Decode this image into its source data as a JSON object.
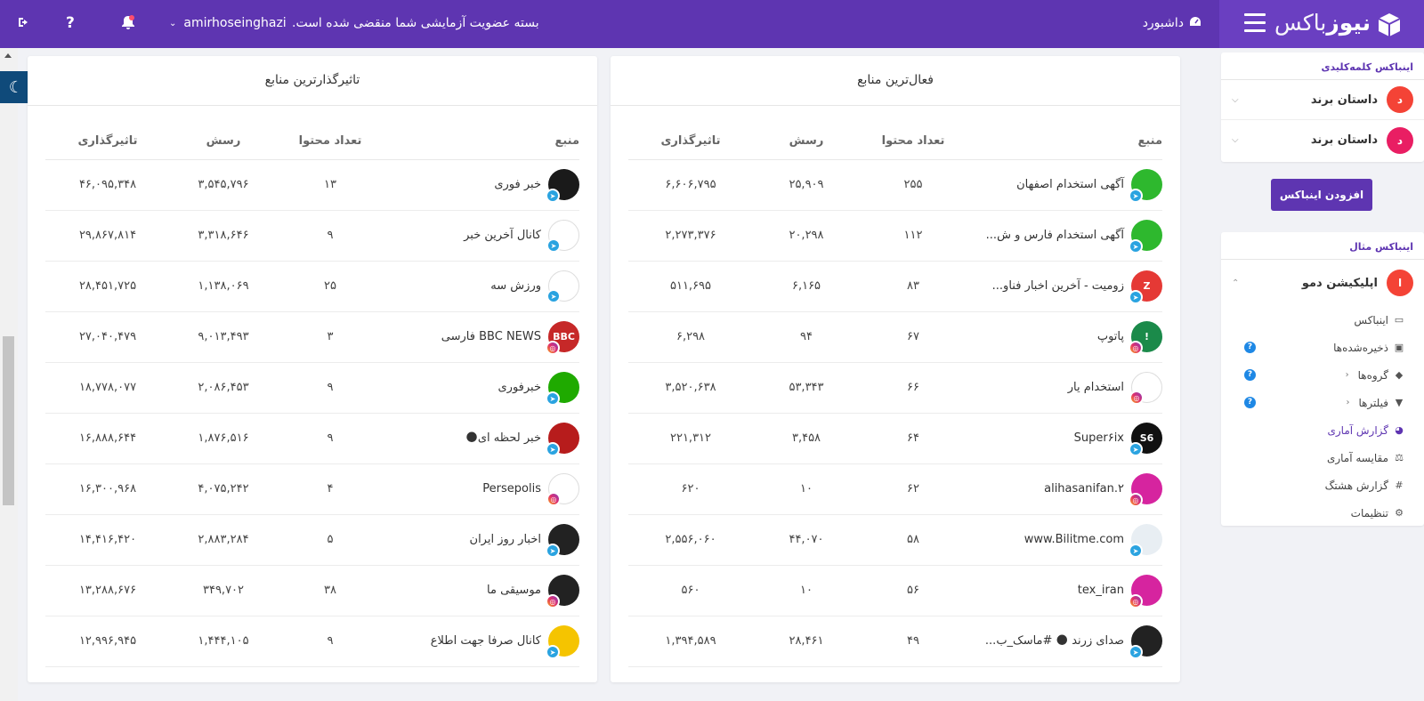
{
  "topbar": {
    "brand_bold": "نیوز",
    "brand_light": "باکس",
    "dashboard_label": "داشبورد",
    "subscription_msg": "بسته عضویت آزمایشی شما منقضی شده است.",
    "username": "amirhoseinghazi",
    "help_label": "?",
    "bar_color": "#5e35b1"
  },
  "active_sources": {
    "title": "فعال‌ترین منابع",
    "headers": [
      "منبع",
      "تعداد محتوا",
      "رسش",
      "تاثیرگذاری"
    ],
    "rows": [
      {
        "name": "آگهی استخدام اصفهان",
        "count": "۲۵۵",
        "reach": "۲۵,۹۰۹",
        "impact": "۶,۶۰۶,۷۹۵",
        "platform": "tg",
        "avatar_color": "#2eb82e",
        "avatar_text": ""
      },
      {
        "name": "آگهی استخدام فارس و ش...",
        "count": "۱۱۲",
        "reach": "۲۰,۲۹۸",
        "impact": "۲,۲۷۳,۳۷۶",
        "platform": "tg",
        "avatar_color": "#2eb82e",
        "avatar_text": ""
      },
      {
        "name": "زومیت - آخرین اخبار فناو...",
        "count": "۸۳",
        "reach": "۶,۱۶۵",
        "impact": "۵۱۱,۶۹۵",
        "platform": "tg",
        "avatar_color": "#e53935",
        "avatar_text": "Z"
      },
      {
        "name": "پاتوپ",
        "count": "۶۷",
        "reach": "۹۴",
        "impact": "۶,۲۹۸",
        "platform": "ig",
        "avatar_color": "#1b8a4a",
        "avatar_text": "!"
      },
      {
        "name": "استخدام یار",
        "count": "۶۶",
        "reach": "۵۳,۳۴۳",
        "impact": "۳,۵۲۰,۶۳۸",
        "platform": "ig",
        "avatar_color": "#ffffff",
        "avatar_text": ""
      },
      {
        "name": "Super۶ix",
        "count": "۶۴",
        "reach": "۳,۴۵۸",
        "impact": "۲۲۱,۳۱۲",
        "platform": "tg",
        "avatar_color": "#111111",
        "avatar_text": "S6"
      },
      {
        "name": "alihasanifan.۲",
        "count": "۶۲",
        "reach": "۱۰",
        "impact": "۶۲۰",
        "platform": "ig",
        "avatar_color": "#d6249f",
        "avatar_text": ""
      },
      {
        "name": "www.Bilitme.com",
        "count": "۵۸",
        "reach": "۴۴,۰۷۰",
        "impact": "۲,۵۵۶,۰۶۰",
        "platform": "tg",
        "avatar_color": "#e8eef3",
        "avatar_text": ""
      },
      {
        "name": "tex_iran",
        "count": "۵۶",
        "reach": "۱۰",
        "impact": "۵۶۰",
        "platform": "ig",
        "avatar_color": "#d6249f",
        "avatar_text": ""
      },
      {
        "name": "صدای زرند 🌑 #ماسک_ب...",
        "count": "۴۹",
        "reach": "۲۸,۴۶۱",
        "impact": "۱,۳۹۴,۵۸۹",
        "platform": "tg",
        "avatar_color": "#222222",
        "avatar_text": ""
      }
    ]
  },
  "influential_sources": {
    "title": "تاثیرگذارترین منابع",
    "headers": [
      "منبع",
      "تعداد محتوا",
      "رسش",
      "تاثیرگذاری"
    ],
    "rows": [
      {
        "name": "خبر فوری",
        "count": "۱۳",
        "reach": "۳,۵۴۵,۷۹۶",
        "impact": "۴۶,۰۹۵,۳۴۸",
        "platform": "tg",
        "avatar_color": "#1a1a1a",
        "avatar_text": ""
      },
      {
        "name": "کانال آخرین خبر",
        "count": "۹",
        "reach": "۳,۳۱۸,۶۴۶",
        "impact": "۲۹,۸۶۷,۸۱۴",
        "platform": "tg",
        "avatar_color": "#ffffff",
        "avatar_text": ""
      },
      {
        "name": "ورزش سه",
        "count": "۲۵",
        "reach": "۱,۱۳۸,۰۶۹",
        "impact": "۲۸,۴۵۱,۷۲۵",
        "platform": "tg",
        "avatar_color": "#ffffff",
        "avatar_text": ""
      },
      {
        "name": "BBC NEWS فارسی",
        "count": "۳",
        "reach": "۹,۰۱۳,۴۹۳",
        "impact": "۲۷,۰۴۰,۴۷۹",
        "platform": "ig",
        "avatar_color": "#c62828",
        "avatar_text": "BBC"
      },
      {
        "name": "خبرفوری",
        "count": "۹",
        "reach": "۲,۰۸۶,۴۵۳",
        "impact": "۱۸,۷۷۸,۰۷۷",
        "platform": "tg",
        "avatar_color": "#1faa00",
        "avatar_text": ""
      },
      {
        "name": "خبر لحظه ای🌑",
        "count": "۹",
        "reach": "۱,۸۷۶,۵۱۶",
        "impact": "۱۶,۸۸۸,۶۴۴",
        "platform": "tg",
        "avatar_color": "#b71c1c",
        "avatar_text": ""
      },
      {
        "name": "Persepolis",
        "count": "۴",
        "reach": "۴,۰۷۵,۲۴۲",
        "impact": "۱۶,۳۰۰,۹۶۸",
        "platform": "ig",
        "avatar_color": "#ffffff",
        "avatar_text": ""
      },
      {
        "name": "اخبار روز ایران",
        "count": "۵",
        "reach": "۲,۸۸۳,۲۸۴",
        "impact": "۱۴,۴۱۶,۴۲۰",
        "platform": "tg",
        "avatar_color": "#222222",
        "avatar_text": ""
      },
      {
        "name": "موسیقی ما",
        "count": "۳۸",
        "reach": "۳۴۹,۷۰۲",
        "impact": "۱۳,۲۸۸,۶۷۶",
        "platform": "ig",
        "avatar_color": "#222222",
        "avatar_text": ""
      },
      {
        "name": "کانال صرفا جهت اطلاع",
        "count": "۹",
        "reach": "۱,۴۴۴,۱۰۵",
        "impact": "۱۲,۹۹۶,۹۴۵",
        "platform": "tg",
        "avatar_color": "#f5c400",
        "avatar_text": ""
      }
    ]
  },
  "sidebar": {
    "keyword_box_title": "اینباکس کلمه‌کلیدی",
    "keyword_items": [
      {
        "label": "داستان برند",
        "letter": "د",
        "color": "#f44336"
      },
      {
        "label": "داستان برند",
        "letter": "د",
        "color": "#e91e63"
      }
    ],
    "add_inbox_label": "افزودن اینباکس",
    "example_box_title": "اینباکس مثال",
    "demo_app": {
      "label": "اپلیکیشن دمو",
      "letter": "ا",
      "color": "#f44336"
    },
    "menu": [
      {
        "label": "اینباکس",
        "icon": "inbox-icon",
        "glyph": "▭"
      },
      {
        "label": "ذخیره‌شده‌ها",
        "icon": "save-icon",
        "glyph": "▣",
        "help": true
      },
      {
        "label": "گروه‌ها",
        "icon": "tags-icon",
        "glyph": "◆",
        "help": true,
        "chevron": true
      },
      {
        "label": "فیلترها",
        "icon": "filter-icon",
        "glyph": "▼",
        "help": true,
        "chevron": true
      },
      {
        "label": "گزارش آماری",
        "icon": "pie-chart-icon",
        "glyph": "◕",
        "active": true
      },
      {
        "label": "مقایسه آماری",
        "icon": "balance-icon",
        "glyph": "⚖"
      },
      {
        "label": "گزارش هشتگ",
        "icon": "hashtag-icon",
        "glyph": "#"
      },
      {
        "label": "تنظیمات",
        "icon": "gear-icon",
        "glyph": "⚙"
      }
    ]
  }
}
